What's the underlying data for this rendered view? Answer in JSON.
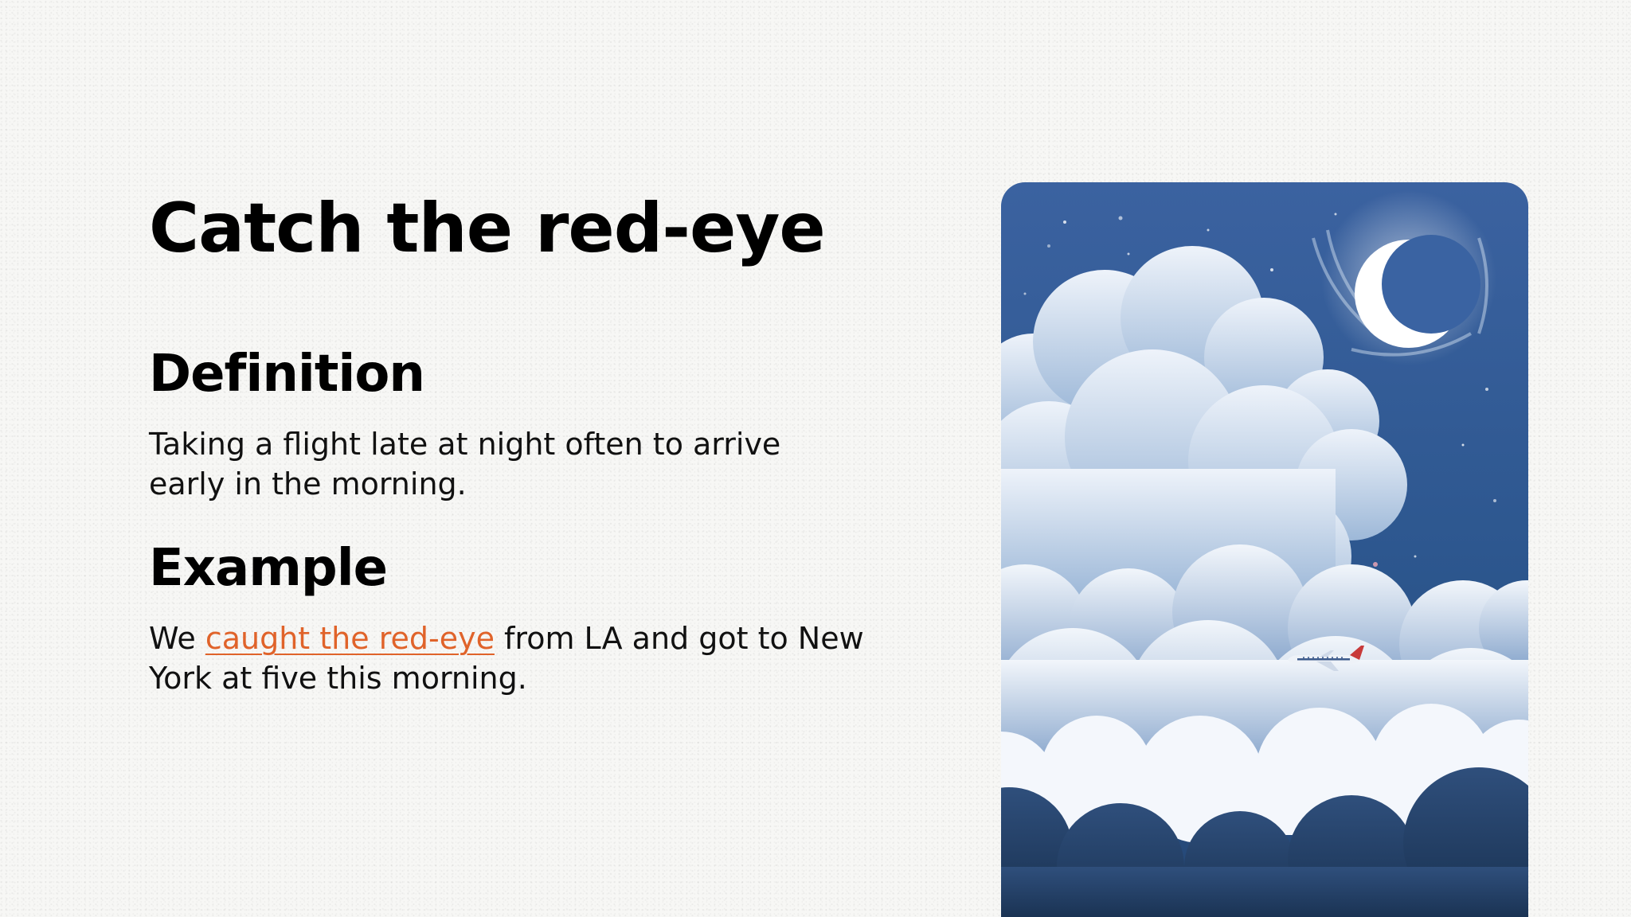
{
  "title": "Catch the red-eye",
  "definition": {
    "heading": "Definition",
    "text": "Taking a flight late at night often to arrive early in the morning."
  },
  "example": {
    "heading": "Example",
    "text_before": "We ",
    "phrase": "caught the red-eye",
    "text_after": " from LA and got to New York at five this morning."
  },
  "colors": {
    "accent_link": "#e0632a",
    "night_sky": "#2b4f86",
    "cloud": "#dfe9f5"
  },
  "illustration": {
    "icons": [
      "crescent-moon-icon",
      "airplane-icon"
    ]
  }
}
